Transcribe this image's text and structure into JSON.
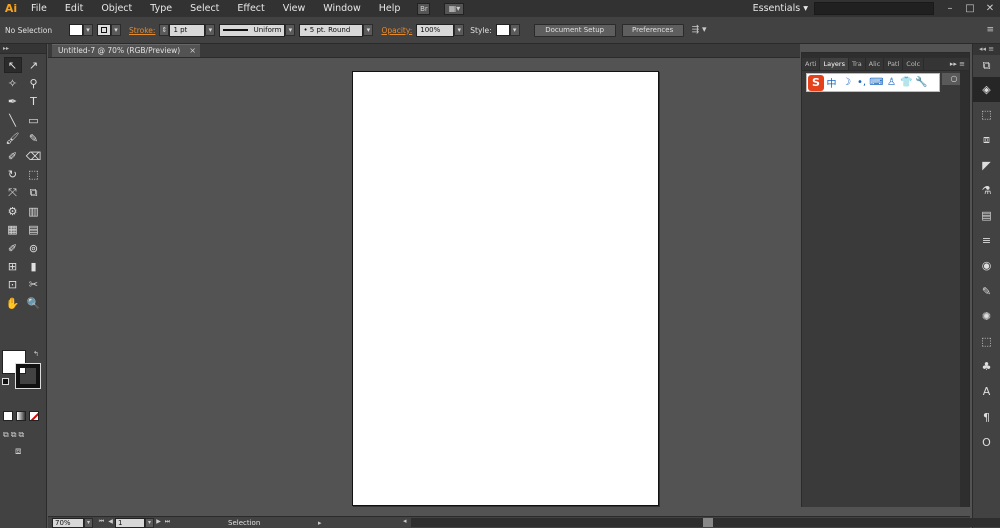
{
  "app": {
    "logo": "Ai"
  },
  "menu": [
    "File",
    "Edit",
    "Object",
    "Type",
    "Select",
    "Effect",
    "View",
    "Window",
    "Help"
  ],
  "menubar_right": {
    "workspace": "Essentials ▾",
    "minimize": "–",
    "maximize": "□",
    "close": "✕"
  },
  "control": {
    "selection_label": "No Selection",
    "stroke_label": "Stroke:",
    "stroke_value": "1 pt",
    "profile_value": "Uniform",
    "brush_value": "5 pt. Round",
    "opacity_label": "Opacity:",
    "opacity_value": "100%",
    "style_label": "Style:",
    "doc_setup_label": "Document Setup",
    "preferences_label": "Preferences"
  },
  "document": {
    "tab_title": "Untitled-7 @ 70% (RGB/Preview)",
    "close": "×"
  },
  "status": {
    "zoom": "70%",
    "page": "1",
    "tool": "Selection"
  },
  "layers_panel": {
    "tabs": [
      "Arti",
      "Layers",
      "Tra",
      "Alic",
      "Patl",
      "Colc"
    ],
    "menu_icon": "▸▸ ≡",
    "ime_logo": "S",
    "ime_icons": [
      "中",
      "☽",
      "•,",
      "⌨",
      "♙",
      "👕",
      "🔧"
    ]
  },
  "tools": [
    [
      "↖",
      "↗"
    ],
    [
      "✧",
      "⚲"
    ],
    [
      "✒",
      "T"
    ],
    [
      "╲",
      "▭"
    ],
    [
      "🖌",
      "✎"
    ],
    [
      "✐",
      "⌫"
    ],
    [
      "↻",
      "⬚"
    ],
    [
      "⤧",
      "⧉"
    ],
    [
      "⚙",
      "▥"
    ],
    [
      "▦",
      "▤"
    ],
    [
      "✐",
      "⊚"
    ],
    [
      "⊞",
      "▮"
    ],
    [
      "⊡",
      "✂"
    ],
    [
      "✋",
      "🔍"
    ]
  ],
  "dock_icons": [
    "⧉",
    "◈",
    "⬚",
    "⧈",
    "◤",
    "⚗",
    "▤",
    "≡",
    "◉",
    "✎",
    "✺",
    "⬚",
    "♣",
    "A",
    "¶",
    "O"
  ]
}
